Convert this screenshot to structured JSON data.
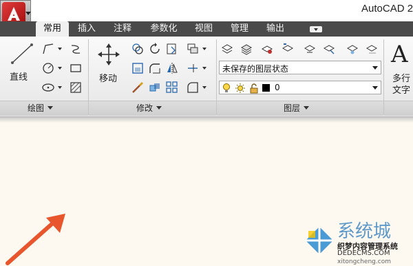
{
  "window": {
    "title": "AutoCAD 2"
  },
  "app_button": {
    "icon": "autocad-logo-icon"
  },
  "tabs": [
    {
      "label": "常用",
      "active": true
    },
    {
      "label": "插入",
      "active": false
    },
    {
      "label": "注释",
      "active": false
    },
    {
      "label": "参数化",
      "active": false
    },
    {
      "label": "视图",
      "active": false
    },
    {
      "label": "管理",
      "active": false
    },
    {
      "label": "输出",
      "active": false
    }
  ],
  "ribbon": {
    "draw_panel": {
      "label": "绘图",
      "line_label": "直线"
    },
    "modify_panel": {
      "label": "修改",
      "move_label": "移动"
    },
    "layers_panel": {
      "label": "图层",
      "layer_state_value": "未保存的图层状态",
      "current_layer_value": "0"
    },
    "annotation_panel": {
      "big_letter": "A",
      "mtext_label_line1": "多行",
      "mtext_label_line2": "文字"
    }
  },
  "watermark": {
    "text": "系统城",
    "sub1": "织梦内容管理系统",
    "sub2": "DEDECMS.COM",
    "url": "xitongcheng.com"
  },
  "colors": {
    "tab_bar": "#4a4a4a",
    "ribbon": "#eeeeee",
    "canvas": "#fdf9f0",
    "annotation_arrow": "#e8562e"
  }
}
